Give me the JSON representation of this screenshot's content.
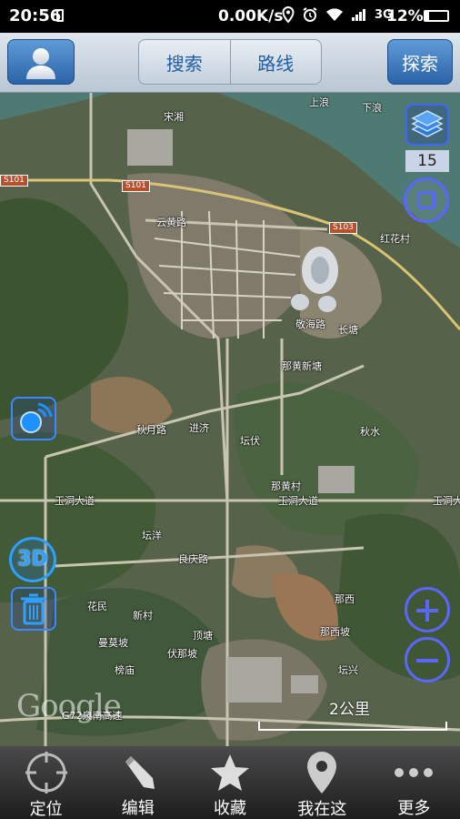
{
  "status_bar": {
    "time": "20:56",
    "network_speed": "0.00K/s",
    "network_type": "3G",
    "battery": "12%"
  },
  "toolbar": {
    "avatar_icon": "user-avatar-icon",
    "tabs": [
      {
        "label": "搜索"
      },
      {
        "label": "路线"
      }
    ],
    "explore_label": "探索"
  },
  "map": {
    "zoom_level": "15",
    "threed_label": "3D",
    "scale_label": "2公里",
    "watermark": "Google",
    "place_labels": [
      "宋湘",
      "上浪",
      "下浪",
      "云黄路",
      "敬海路",
      "长塘",
      "那黄新塘",
      "秋月路",
      "进济",
      "坛伏",
      "那黄村",
      "玉洞大道",
      "玉洞大道",
      "玉洞大道",
      "坛洋",
      "良庆路",
      "花民",
      "新村",
      "曼莫坡",
      "顶塘",
      "榜庙",
      "伏那坡",
      "那西坡",
      "那西",
      "坛兴",
      "G72泉南高速",
      "红花村",
      "秋水"
    ],
    "road_shields": [
      "S101",
      "S101",
      "S103"
    ]
  },
  "bottom_nav": {
    "items": [
      {
        "label": "定位",
        "icon": "locate-crosshair-icon"
      },
      {
        "label": "编辑",
        "icon": "pencil-icon"
      },
      {
        "label": "收藏",
        "icon": "star-icon"
      },
      {
        "label": "我在这",
        "icon": "map-pin-icon"
      },
      {
        "label": "更多",
        "icon": "more-dots-icon"
      }
    ]
  }
}
